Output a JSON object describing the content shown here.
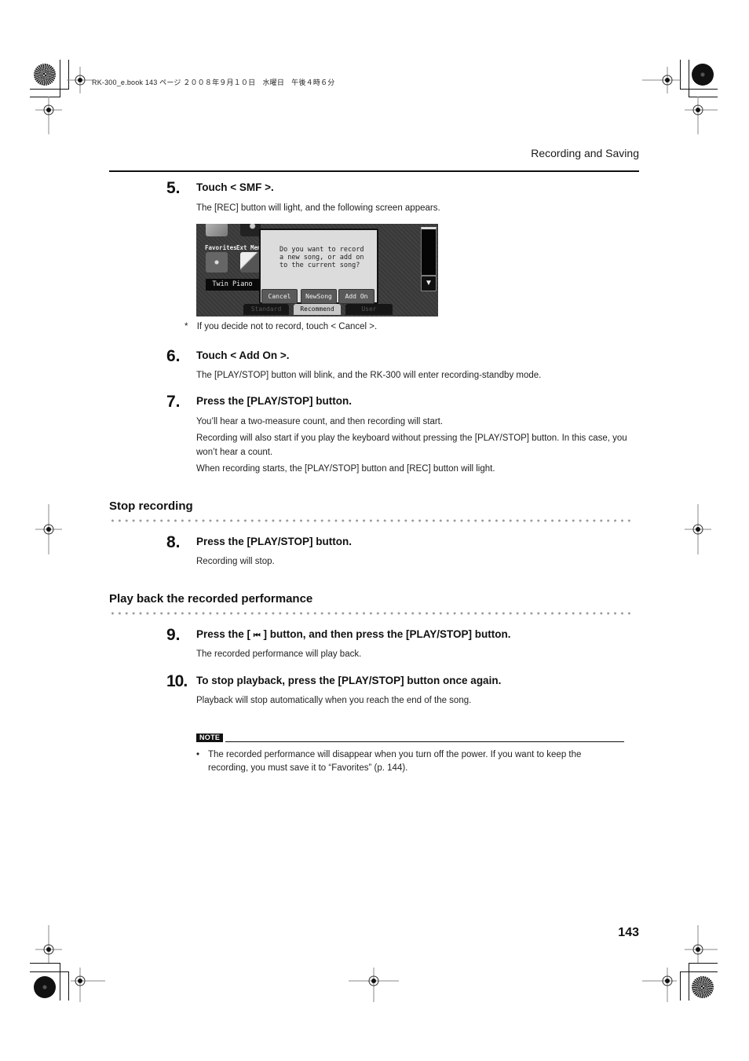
{
  "print_meta": "RK-300_e.book  143 ページ  ２００８年９月１０日　水曜日　午後４時６分",
  "running_head": "Recording and Saving",
  "steps": [
    {
      "num": "5.",
      "title": "Touch < SMF >.",
      "body": [
        "The [REC] button will light, and the following screen appears."
      ]
    },
    {
      "num": "6.",
      "title": "Touch < Add On >.",
      "body": [
        "The [PLAY/STOP] button will blink, and the RK-300 will enter recording-standby mode."
      ]
    },
    {
      "num": "7.",
      "title": "Press the [PLAY/STOP] button.",
      "body": [
        "You’ll hear a two-measure count, and then recording will start.",
        "Recording will also start if you play the keyboard without pressing the [PLAY/STOP] button. In this case, you won’t hear a count.",
        "When recording starts, the [PLAY/STOP] button and [REC] button will light."
      ]
    },
    {
      "num": "8.",
      "title": "Press the [PLAY/STOP] button.",
      "body": [
        "Recording will stop."
      ]
    },
    {
      "num": "9.",
      "title_pre": "Press the [ ",
      "title_icon": "rewind-to-start-icon",
      "title_icon_glyph": "⏮",
      "title_post": " ] button, and then press the [PLAY/STOP] button.",
      "body": [
        "The recorded performance will play back."
      ]
    },
    {
      "num": "10.",
      "title": "To stop playback, press the [PLAY/STOP] button once again.",
      "body": [
        "Playback will stop automatically when you reach the end of the song."
      ]
    }
  ],
  "footnote": {
    "mark": "*",
    "text": "If you decide not to record, touch < Cancel >."
  },
  "sections": [
    {
      "title": "Stop recording"
    },
    {
      "title": "Play back the recorded performance"
    }
  ],
  "device_screen": {
    "tiles": [
      {
        "label": "Favorites",
        "icon": "sparkle-icon"
      },
      {
        "label": "Ext Memo",
        "icon": "usb-memory-icon"
      }
    ],
    "tone_name": "Twin Piano",
    "dialog_message": "Do you want to record\na new song, or add on\nto the current song?",
    "dialog_buttons": [
      "Cancel",
      "NewSong",
      "Add On"
    ],
    "scroll_down_glyph": "▼",
    "tabs": [
      {
        "label": "Standard",
        "active": false
      },
      {
        "label": "Recommend",
        "active": true
      },
      {
        "label": "User",
        "active": false
      }
    ]
  },
  "note": {
    "badge": "NOTE",
    "bullet": "•",
    "text": "The recorded performance will disappear when you turn off the power. If you want to keep the recording, you must save it to “Favorites” (p. 144)."
  },
  "page_number": "143"
}
